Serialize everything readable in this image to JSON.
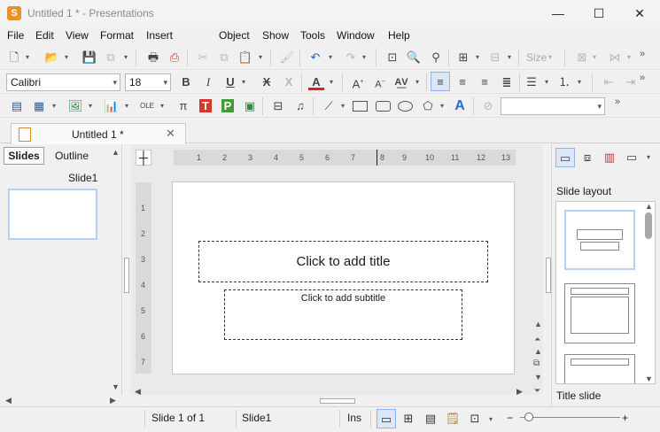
{
  "window": {
    "title": "Untitled 1 * - Presentations",
    "app_icon_letter": "S",
    "minimize": "—",
    "maximize": "☐",
    "close": "✕"
  },
  "menu": [
    "File",
    "Edit",
    "View",
    "Format",
    "Insert",
    "Object",
    "Show",
    "Tools",
    "Window",
    "Help"
  ],
  "toolbar": {
    "font_name": "Calibri",
    "font_size": "18",
    "size_label": "Size",
    "object_name_value": ""
  },
  "document_tab": {
    "label": "Untitled 1 *",
    "close": "✕"
  },
  "left_panel": {
    "tabs": [
      "Slides",
      "Outline"
    ],
    "active_tab": "Slides",
    "slides": [
      {
        "label": "Slide1"
      }
    ]
  },
  "ruler": {
    "horizontal": [
      "1",
      "2",
      "3",
      "4",
      "5",
      "6",
      "7",
      "8",
      "9",
      "10",
      "11",
      "12",
      "13"
    ],
    "vertical": [
      "1",
      "2",
      "3",
      "4",
      "5",
      "6",
      "7"
    ]
  },
  "slide": {
    "title_placeholder": "Click to add title",
    "subtitle_placeholder": "Click to add subtitle"
  },
  "right_panel": {
    "heading": "Slide layout",
    "selected_layout": "Title slide"
  },
  "status": {
    "slide_position": "Slide 1 of 1",
    "slide_name": "Slide1",
    "insert_mode": "Ins",
    "zoom_minus": "−",
    "zoom_plus": "+"
  },
  "colors": {
    "accent": "#3c78d8",
    "font_color_underline": "#e02020",
    "app_icon": "#e8912d",
    "selection_border": "#b7cdf2"
  }
}
